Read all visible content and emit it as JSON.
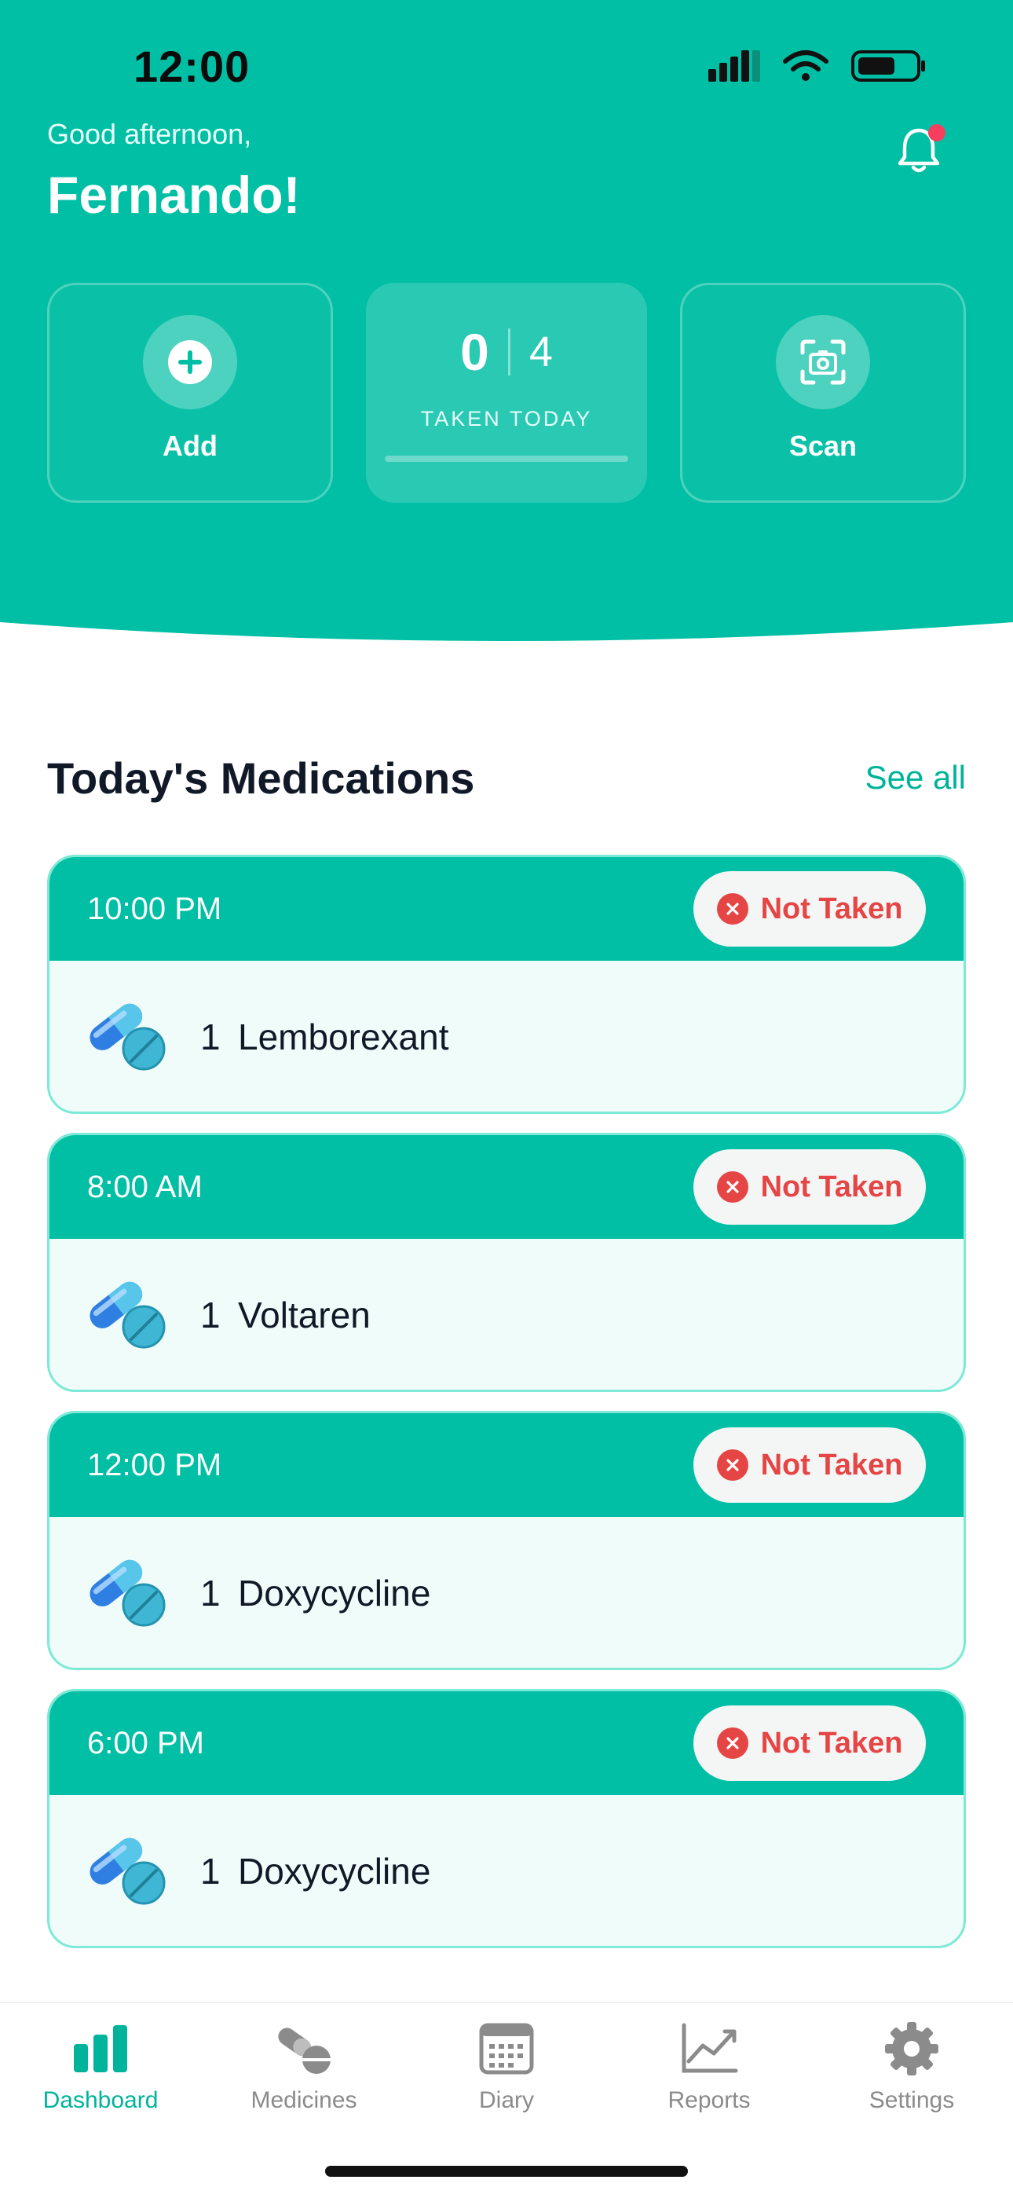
{
  "status_bar": {
    "time": "12:00"
  },
  "header": {
    "greeting": "Good afternoon,",
    "user_name": "Fernando!"
  },
  "actions": {
    "add_label": "Add",
    "scan_label": "Scan",
    "taken_count": "0",
    "total_count": "4",
    "taken_label": "TAKEN TODAY",
    "progress_fraction": 0
  },
  "section": {
    "title": "Today's Medications",
    "see_all": "See all"
  },
  "medications": [
    {
      "time": "10:00 PM",
      "status": "Not Taken",
      "quantity": "1",
      "name": "Lemborexant"
    },
    {
      "time": "8:00 AM",
      "status": "Not Taken",
      "quantity": "1",
      "name": "Voltaren"
    },
    {
      "time": "12:00 PM",
      "status": "Not Taken",
      "quantity": "1",
      "name": "Doxycycline"
    },
    {
      "time": "6:00 PM",
      "status": "Not Taken",
      "quantity": "1",
      "name": "Doxycycline"
    }
  ],
  "nav": {
    "items": [
      {
        "label": "Dashboard",
        "icon": "bar-chart-icon",
        "active": true
      },
      {
        "label": "Medicines",
        "icon": "pills-icon",
        "active": false
      },
      {
        "label": "Diary",
        "icon": "calendar-icon",
        "active": false
      },
      {
        "label": "Reports",
        "icon": "trend-chart-icon",
        "active": false
      },
      {
        "label": "Settings",
        "icon": "gear-icon",
        "active": false
      }
    ]
  },
  "colors": {
    "brand": "#00BFA5",
    "accent_text": "#00B39B",
    "danger": "#E64545",
    "card_background": "#EFFCFA",
    "card_border": "#7DE9D6"
  }
}
